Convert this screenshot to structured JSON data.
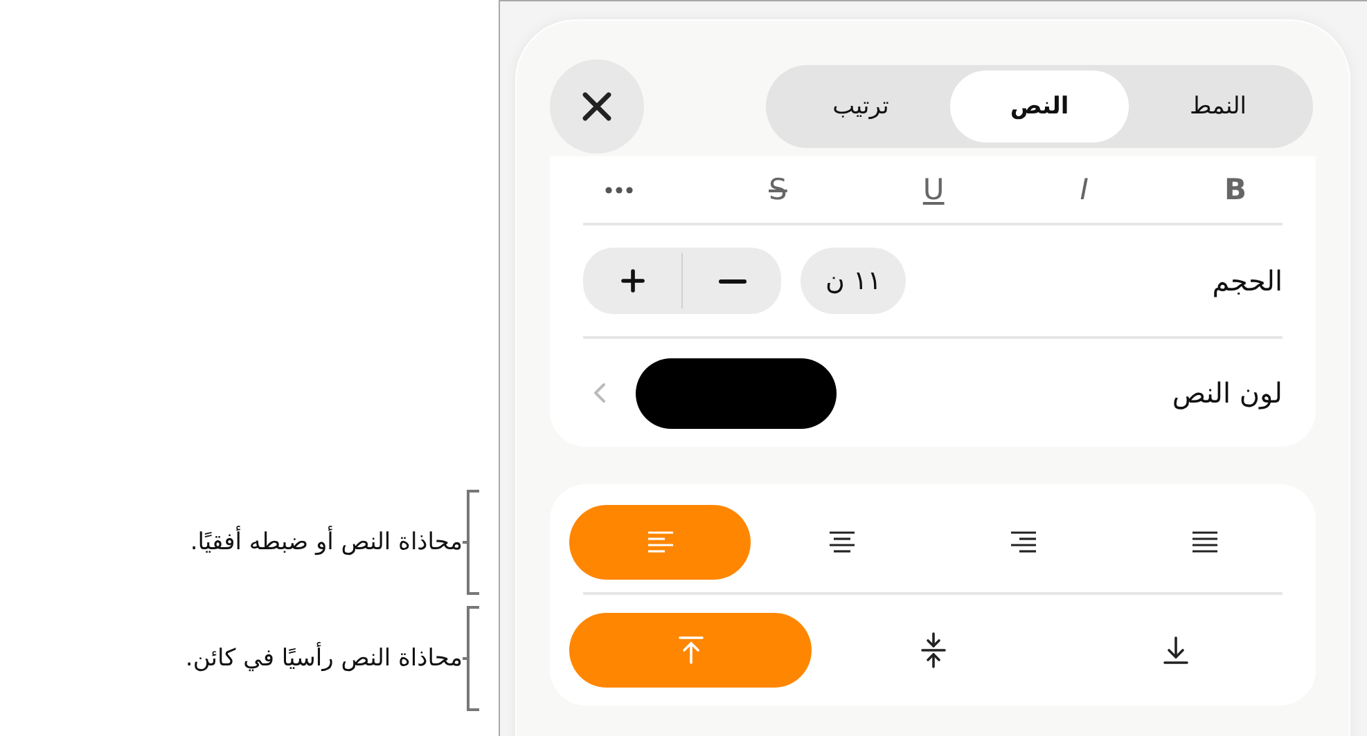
{
  "callouts": [
    {
      "text": "محاذاة النص أو ضبطه أفقيًا."
    },
    {
      "text": "محاذاة النص رأسيًا في كائن."
    }
  ],
  "tabs": [
    {
      "label": "النمط",
      "selected": false
    },
    {
      "label": "النص",
      "selected": true
    },
    {
      "label": "ترتيب",
      "selected": false
    }
  ],
  "format_buttons": [
    {
      "kind": "bold",
      "label": "B"
    },
    {
      "kind": "italic",
      "label": "I"
    },
    {
      "kind": "underline",
      "label": "U"
    },
    {
      "kind": "strikethrough",
      "label": "S"
    },
    {
      "kind": "more"
    }
  ],
  "size": {
    "label": "الحجم",
    "value": "١١ ن"
  },
  "text_color": {
    "label": "لون النص",
    "color": "#000000"
  },
  "horizontal_alignment": [
    {
      "kind": "left",
      "selected": true
    },
    {
      "kind": "center",
      "selected": false
    },
    {
      "kind": "right",
      "selected": false
    },
    {
      "kind": "justify",
      "selected": false
    }
  ],
  "vertical_alignment": [
    {
      "kind": "top",
      "selected": true
    },
    {
      "kind": "middle",
      "selected": false
    },
    {
      "kind": "bottom",
      "selected": false
    }
  ]
}
